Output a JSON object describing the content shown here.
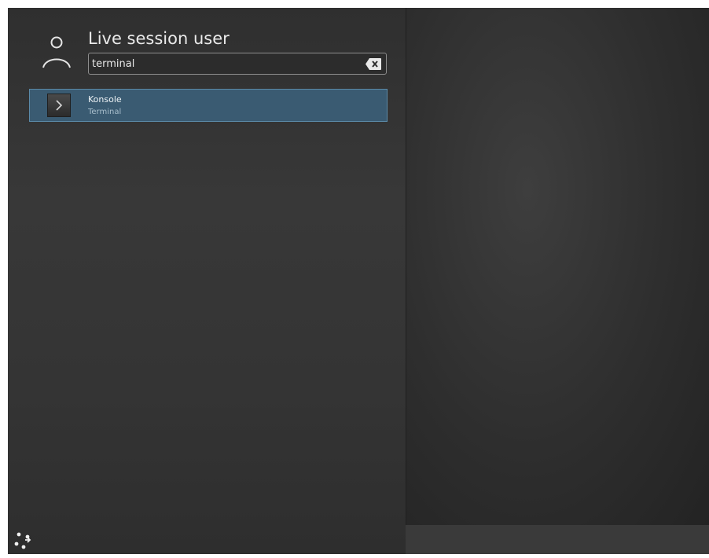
{
  "user": {
    "name": "Live session user",
    "avatar_icon": "user-icon"
  },
  "search": {
    "value": "terminal",
    "clear_icon": "clear-text-icon"
  },
  "results": [
    {
      "title": "Konsole",
      "subtitle": "Terminal",
      "icon": "terminal-icon"
    }
  ],
  "footer": {
    "leave_icon": "leave-icon"
  },
  "colors": {
    "panel_bg": "#373737",
    "highlight": "#3a5b72",
    "highlight_border": "#5b8aa8",
    "text": "#eaeaea"
  }
}
